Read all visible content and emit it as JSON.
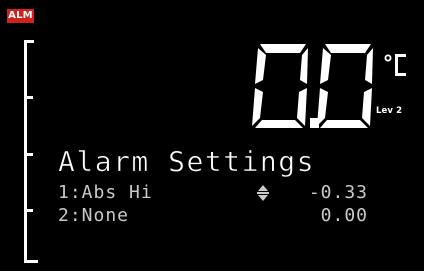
{
  "alarm_badge": "ALM",
  "display": {
    "value": "0.0",
    "unit": "°C",
    "level": "Lev 2"
  },
  "menu": {
    "title": "Alarm Settings",
    "rows": [
      {
        "label": "1:Abs Hi",
        "value": "-0.33",
        "adjust_icon": "up-down-adjust-icon"
      },
      {
        "label": "2:None",
        "value": "0.00"
      }
    ]
  },
  "colors": {
    "background": "#000000",
    "foreground": "#ffffff",
    "dim_text": "#c9c9c9",
    "alarm": "#d0211b"
  }
}
